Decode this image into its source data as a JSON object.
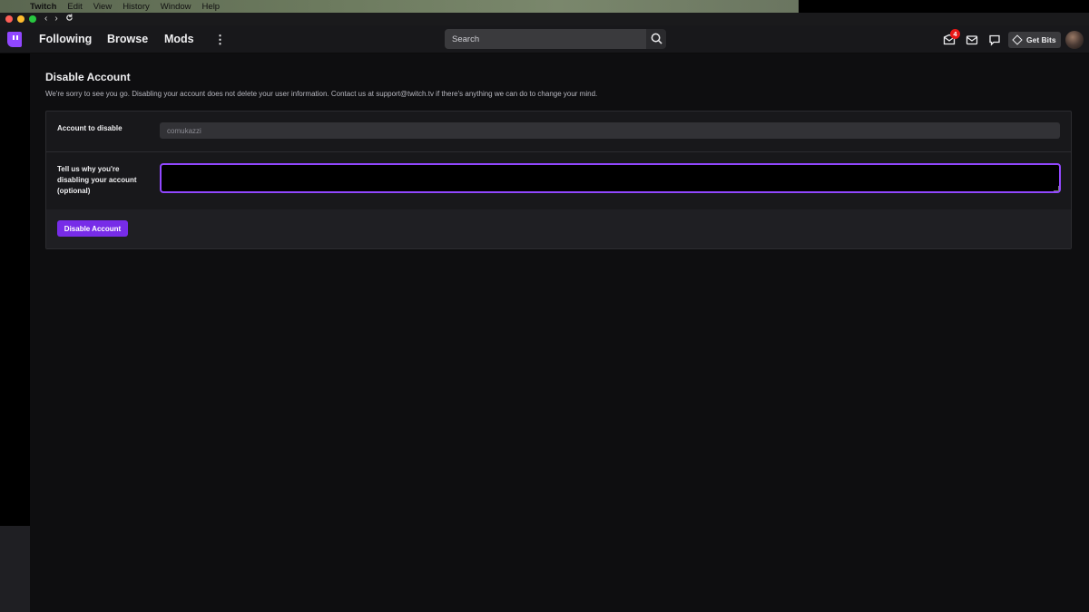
{
  "menubar": {
    "app": "Twitch",
    "items": [
      "Edit",
      "View",
      "History",
      "Window",
      "Help"
    ]
  },
  "nav": {
    "links": [
      "Following",
      "Browse",
      "Mods"
    ],
    "search_placeholder": "Search",
    "notification_count": "4",
    "get_bits": "Get Bits"
  },
  "page": {
    "title": "Disable Account",
    "description": "We're sorry to see you go. Disabling your account does not delete your user information. Contact us at support@twitch.tv if there's anything we can do to change your mind.",
    "account_label": "Account to disable",
    "account_value": "comukazzi",
    "reason_label_line1": "Tell us why you're",
    "reason_label_line2": "disabling your account",
    "reason_label_line3": "(optional)",
    "reason_value": "",
    "disable_button": "Disable Account"
  },
  "colors": {
    "accent": "#9147ff",
    "button": "#772ce8",
    "background": "#0e0e10",
    "badge": "#e91916"
  },
  "icons": [
    "apple-icon",
    "back-icon",
    "forward-icon",
    "reload-icon",
    "twitch-logo-icon",
    "more-icon",
    "search-icon",
    "inbox-icon",
    "whispers-icon",
    "chat-icon",
    "bits-gem-icon"
  ]
}
